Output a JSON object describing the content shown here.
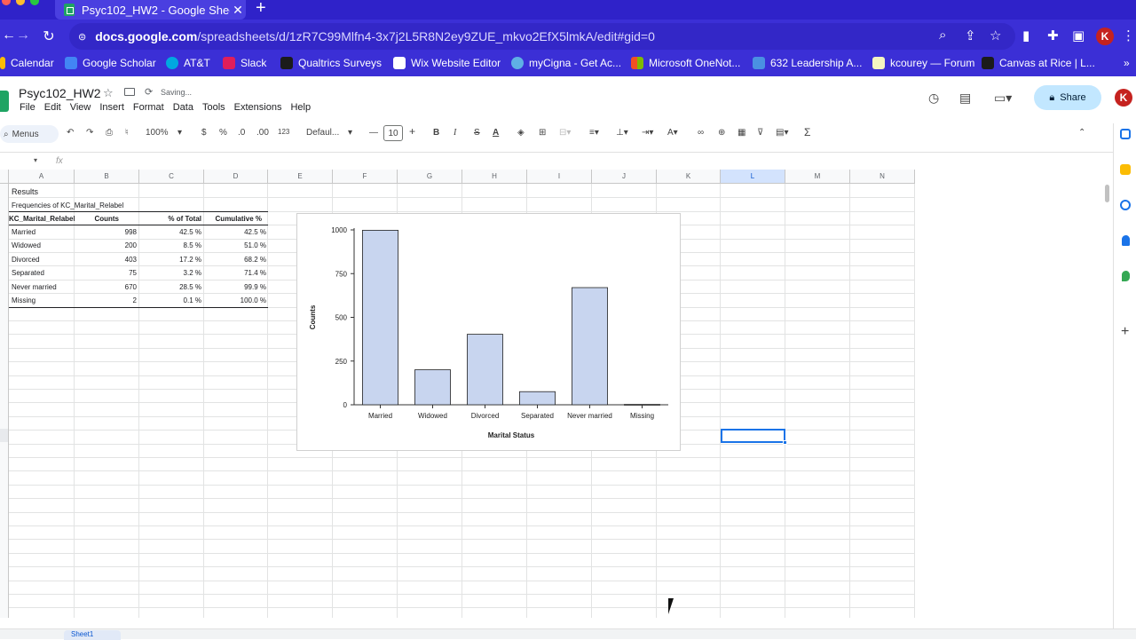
{
  "browser": {
    "tab_title": "Psyc102_HW2 - Google Sheets",
    "tab_close": "✕",
    "new_tab": "+",
    "url_host": "docs.google.com",
    "url_path": "/spreadsheets/d/1zR7C99Mlfn4-3x7j2L5R8N2ey9ZUE_mkvo2EfX5lmkA/edit#gid=0",
    "profile_initial": "K",
    "bookmarks": [
      "Calendar",
      "Google Scholar",
      "AT&T",
      "Slack",
      "Qualtrics Surveys",
      "Wix Website Editor",
      "myCigna - Get Ac...",
      "Microsoft OneNot...",
      "632 Leadership A...",
      "kcourey — Forum",
      "Canvas at Rice | L..."
    ],
    "bookmarks_more": "»"
  },
  "sheets": {
    "doc_title": "Psyc102_HW2",
    "saving": "Saving...",
    "menu": [
      "File",
      "Edit",
      "View",
      "Insert",
      "Format",
      "Data",
      "Tools",
      "Extensions",
      "Help"
    ],
    "share_label": "Share",
    "profile_initial": "K",
    "toolbar": {
      "menus_label": "Menus",
      "zoom": "100%",
      "currency": "$",
      "percent": "%",
      "dec_decrease": ".0",
      "dec_increase": ".00",
      "number_format": "123",
      "font": "Defaul...",
      "font_size": "10",
      "minus": "—",
      "plus": "+",
      "bold": "B",
      "italic": "I",
      "strike": "S",
      "text_color": "A",
      "sigma": "Σ"
    },
    "fx": "fx",
    "columns": [
      "A",
      "B",
      "C",
      "D",
      "E",
      "F",
      "G",
      "H",
      "I",
      "J",
      "K",
      "L",
      "M",
      "N"
    ],
    "selected_column": "L",
    "sheet_tab": "Sheet1"
  },
  "results": {
    "heading": "Results",
    "subheading": "Frequencies of KC_Marital_Relabel",
    "headers": [
      "KC_Marital_Relabel",
      "Counts",
      "% of Total",
      "Cumulative %"
    ],
    "rows": [
      [
        "Married",
        "998",
        "42.5 %",
        "42.5 %"
      ],
      [
        "Widowed",
        "200",
        "8.5 %",
        "51.0 %"
      ],
      [
        "Divorced",
        "403",
        "17.2 %",
        "68.2 %"
      ],
      [
        "Separated",
        "75",
        "3.2 %",
        "71.4 %"
      ],
      [
        "Never married",
        "670",
        "28.5 %",
        "99.9 %"
      ],
      [
        "Missing",
        "2",
        "0.1 %",
        "100.0 %"
      ]
    ]
  },
  "chart_data": {
    "type": "bar",
    "categories": [
      "Married",
      "Widowed",
      "Divorced",
      "Separated",
      "Never married",
      "Missing"
    ],
    "values": [
      998,
      200,
      403,
      75,
      670,
      2
    ],
    "title": "",
    "xlabel": "Marital Status",
    "ylabel": "Counts",
    "ylim": [
      0,
      1000
    ],
    "yticks": [
      0,
      250,
      500,
      750,
      1000
    ],
    "bar_color": "#c8d5ef",
    "grid": false
  },
  "colors": {
    "chrome": "#3b2fd6",
    "share": "#c2e7ff",
    "selection": "#1a73e8"
  }
}
